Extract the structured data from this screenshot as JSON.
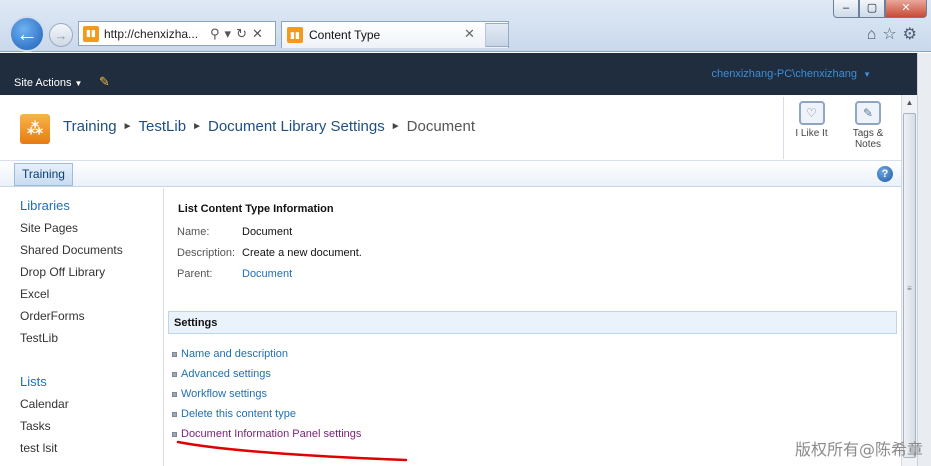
{
  "browser": {
    "address": "http://chenxizha...",
    "tab_title": "Content Type",
    "window_buttons": [
      "–",
      "▢",
      "✕"
    ]
  },
  "ribbon": {
    "site_actions": "Site Actions",
    "user": "chenxizhang-PC\\chenxizhang"
  },
  "breadcrumb": {
    "items": [
      "Training",
      "TestLib",
      "Document Library Settings",
      "Document"
    ]
  },
  "social": {
    "like": "I Like It",
    "tags_line1": "Tags &",
    "tags_line2": "Notes"
  },
  "topnav": {
    "tab": "Training"
  },
  "leftnav": {
    "libraries_header": "Libraries",
    "libraries": [
      "Site Pages",
      "Shared Documents",
      "Drop Off Library",
      "Excel",
      "OrderForms",
      "TestLib"
    ],
    "lists_header": "Lists",
    "lists": [
      "Calendar",
      "Tasks",
      "test lsit"
    ]
  },
  "info": {
    "title": "List Content Type Information",
    "name_label": "Name:",
    "name_value": "Document",
    "description_label": "Description:",
    "description_value": "Create a new document.",
    "parent_label": "Parent:",
    "parent_value": "Document"
  },
  "settings": {
    "header": "Settings",
    "links": [
      "Name and description",
      "Advanced settings",
      "Workflow settings",
      "Delete this content type",
      "Document Information Panel settings"
    ]
  },
  "watermark": "版权所有@陈希章",
  "colors": {
    "ribbon_bg": "#1f2d3e",
    "link": "#1f6fb5",
    "visited_link": "#7a1f7a",
    "annotation": "#e00000"
  }
}
